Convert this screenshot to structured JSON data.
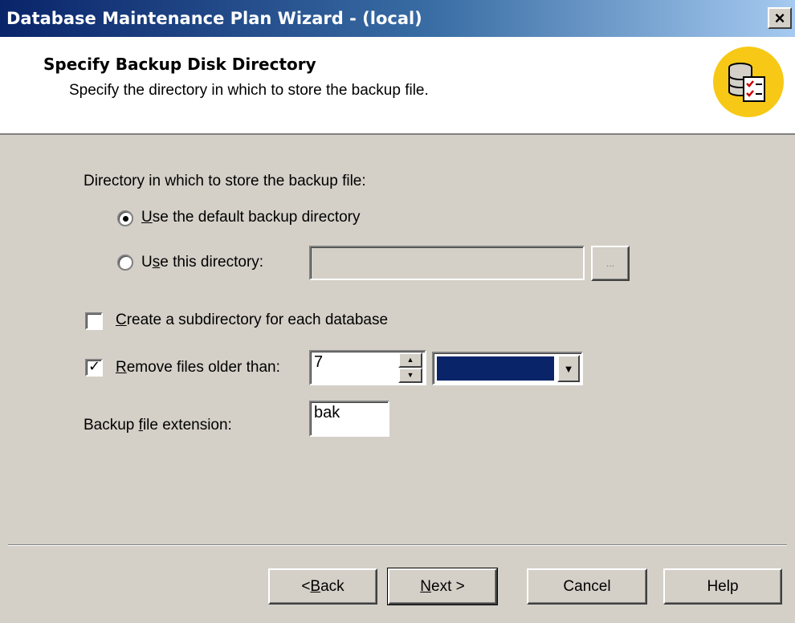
{
  "window": {
    "title": "Database Maintenance Plan Wizard - (local)",
    "close_glyph": "×"
  },
  "header": {
    "title": "Specify Backup Disk Directory",
    "subtitle": "Specify the directory in which to store the backup file.",
    "icon": "database-checklist-icon"
  },
  "form": {
    "directory_label": "Directory in which to store the backup file:",
    "default_dir": {
      "pre": "",
      "key": "U",
      "post": "se the default backup directory",
      "checked": true
    },
    "this_dir": {
      "pre": "U",
      "key": "s",
      "post": "e this directory:",
      "checked": false
    },
    "directory_value": "",
    "browse_label": "...",
    "subdir": {
      "pre": "",
      "key": "C",
      "post": "reate a subdirectory for each database",
      "checked": false
    },
    "remove": {
      "pre": "",
      "key": "R",
      "post": "emove files older than:",
      "checked": true
    },
    "remove_value": "7",
    "remove_unit": "",
    "ext_label": {
      "pre": "Backup ",
      "key": "f",
      "post": "ile extension:"
    },
    "ext_value": "bak"
  },
  "buttons": {
    "back": {
      "pre": "< ",
      "key": "B",
      "post": "ack"
    },
    "next": {
      "pre": "",
      "key": "N",
      "post": "ext >"
    },
    "cancel": "Cancel",
    "help": "Help"
  }
}
